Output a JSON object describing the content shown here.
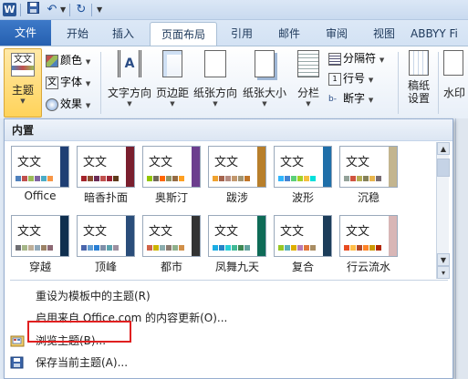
{
  "qat": {
    "app_icon": "W",
    "save_icon": "save-icon",
    "undo_icon": "undo-icon",
    "redo_icon": "redo-icon"
  },
  "tabs": [
    {
      "label": "文件"
    },
    {
      "label": "开始"
    },
    {
      "label": "插入"
    },
    {
      "label": "页面布局"
    },
    {
      "label": "引用"
    },
    {
      "label": "邮件"
    },
    {
      "label": "审阅"
    },
    {
      "label": "视图"
    },
    {
      "label": "ABBYY Fi"
    }
  ],
  "ribbon": {
    "theme": "主题",
    "colors": "颜色",
    "fonts": "字体",
    "effects": "效果",
    "text_direction": "文字方向",
    "margins": "页边距",
    "orientation": "纸张方向",
    "size": "纸张大小",
    "columns": "分栏",
    "breaks": "分隔符",
    "line_numbers": "行号",
    "hyphenation": "断字",
    "draft": "稿纸",
    "draft2": "设置",
    "watermark": "水印"
  },
  "panel": {
    "header": "内置",
    "thumb_text": "文文",
    "themes": [
      {
        "name": "Office",
        "band": "#1f3f74",
        "text": "#222",
        "sw": [
          "#4f81bd",
          "#c0504d",
          "#9bbb59",
          "#8064a2",
          "#4bacc6",
          "#f79646"
        ]
      },
      {
        "name": "暗香扑面",
        "band": "#7a1f2e",
        "text": "#222",
        "sw": [
          "#a3242a",
          "#8b4e2e",
          "#6b2b56",
          "#c0504d",
          "#9b2335",
          "#5e3a1a"
        ]
      },
      {
        "name": "奥斯汀",
        "band": "#6c3e8e",
        "text": "#222",
        "sw": [
          "#94c600",
          "#71685a",
          "#ff6700",
          "#909465",
          "#956b43",
          "#fea022"
        ]
      },
      {
        "name": "跋涉",
        "band": "#b87f2b",
        "text": "#222",
        "sw": [
          "#f0a22e",
          "#a5644e",
          "#b58b80",
          "#c3986d",
          "#a19574",
          "#c17529"
        ]
      },
      {
        "name": "波形",
        "band": "#1f6fa9",
        "text": "#222",
        "sw": [
          "#31b6fd",
          "#4584d3",
          "#5bd078",
          "#a5d028",
          "#f5c040",
          "#05e0db"
        ]
      },
      {
        "name": "沉稳",
        "band": "#c3b58f",
        "text": "#222",
        "sw": [
          "#93a299",
          "#cf543f",
          "#b5ae53",
          "#848058",
          "#e8b54d",
          "#786c71"
        ]
      },
      {
        "name": "穿越",
        "band": "#0f2f4f",
        "text": "#222",
        "sw": [
          "#6f6f74",
          "#a7b789",
          "#beae98",
          "#92a9b9",
          "#9c8265",
          "#8d6974"
        ]
      },
      {
        "name": "顶峰",
        "band": "#2a4d7a",
        "text": "#222",
        "sw": [
          "#4a66ac",
          "#629dd1",
          "#297fd5",
          "#7f8fa9",
          "#5aa2ae",
          "#9d90a0"
        ]
      },
      {
        "name": "都市",
        "band": "#333333",
        "text": "#222",
        "sw": [
          "#d16349",
          "#ccb400",
          "#8cadae",
          "#8c7b70",
          "#8fb08c",
          "#d19049"
        ]
      },
      {
        "name": "凤舞九天",
        "band": "#0e6b57",
        "text": "#222",
        "sw": [
          "#1cade4",
          "#2683c6",
          "#27ced7",
          "#42ba97",
          "#3e8853",
          "#62a39f"
        ]
      },
      {
        "name": "复合",
        "band": "#1c3d5a",
        "text": "#222",
        "sw": [
          "#98c723",
          "#59b0b9",
          "#deae00",
          "#b77bb4",
          "#e0773c",
          "#a98d63"
        ]
      },
      {
        "name": "行云流水",
        "band": "#d8b6b6",
        "text": "#222",
        "sw": [
          "#e84c22",
          "#ffbd47",
          "#b64926",
          "#ff8427",
          "#cc9900",
          "#b22600"
        ]
      }
    ],
    "menu": {
      "reset": "重设为模板中的主题(R)",
      "update": "启用来自 Office.com 的内容更新(O)...",
      "browse": "浏览主题(B)...",
      "save": "保存当前主题(A)..."
    }
  },
  "colors": {
    "accent": "#2660b0",
    "highlight": "#e02020"
  }
}
